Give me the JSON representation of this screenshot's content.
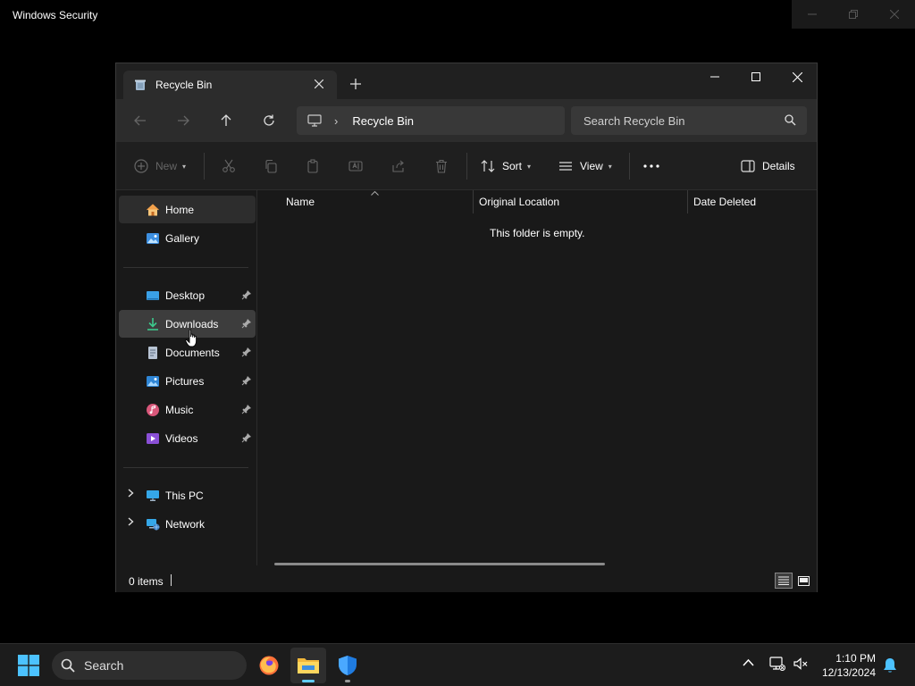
{
  "background_window": {
    "title": "Windows Security"
  },
  "explorer": {
    "tab": {
      "label": "Recycle Bin"
    },
    "address": {
      "crumb": "Recycle Bin"
    },
    "search": {
      "placeholder": "Search Recycle Bin"
    },
    "command_bar": {
      "new_label": "New",
      "sort_label": "Sort",
      "view_label": "View",
      "details_label": "Details"
    },
    "sidebar": {
      "home": "Home",
      "gallery": "Gallery",
      "desktop": "Desktop",
      "downloads": "Downloads",
      "documents": "Documents",
      "pictures": "Pictures",
      "music": "Music",
      "videos": "Videos",
      "this_pc": "This PC",
      "network": "Network"
    },
    "columns": {
      "name": "Name",
      "original_location": "Original Location",
      "date_deleted": "Date Deleted"
    },
    "empty_message": "This folder is empty.",
    "status": {
      "item_count": "0 items"
    }
  },
  "taskbar": {
    "search_label": "Search",
    "time": "1:10 PM",
    "date": "12/13/2024"
  },
  "colors": {
    "accent": "#60cdff",
    "window_bg": "#191919",
    "toolbar_bg": "#2c2c2c"
  }
}
